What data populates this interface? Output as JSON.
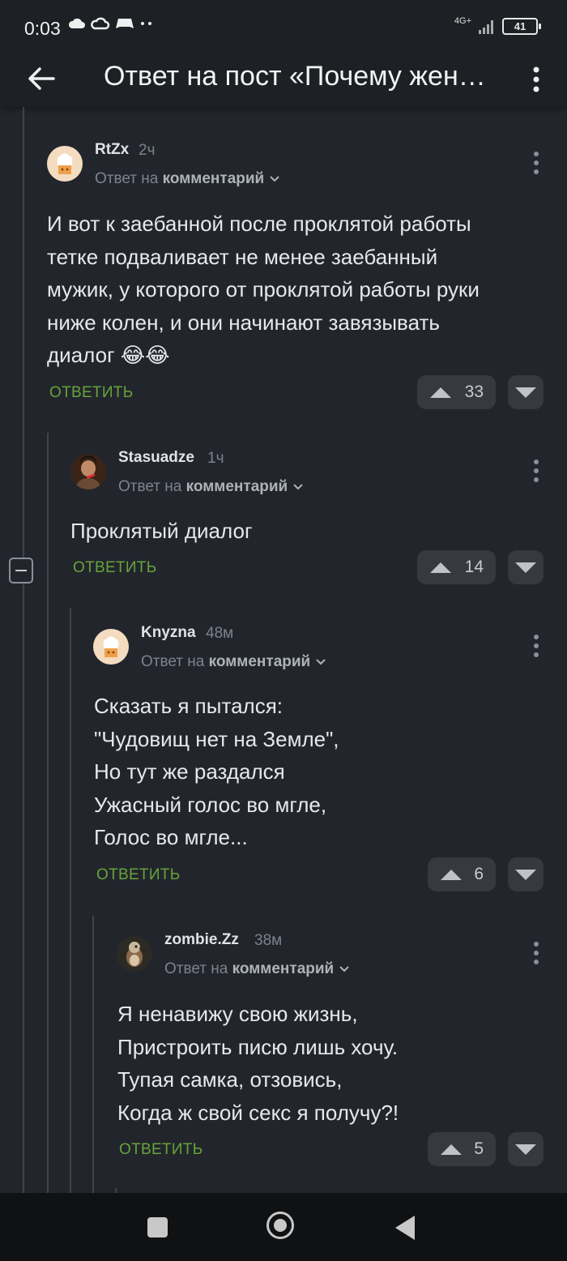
{
  "status_bar": {
    "time": "0:03",
    "network": "4G+",
    "battery": "41"
  },
  "app_bar": {
    "title": "Ответ на пост «Почему жен…"
  },
  "comments": [
    {
      "author": "RtZx",
      "time": "2ч",
      "reply_prefix": "Ответ на",
      "reply_target": "комментарий",
      "body": "И вот к заебанной после проклятой работы\nтетке подваливает не менее заебанный\nмужик, у которого от проклятой работы руки\nниже колен, и они начинают завязывать\nдиалог 😂😂",
      "reply_label": "ОТВЕТИТЬ",
      "votes": "33"
    },
    {
      "author": "Stasuadze",
      "time": "1ч",
      "reply_prefix": "Ответ на",
      "reply_target": "комментарий",
      "body": "Проклятый диалог",
      "reply_label": "ОТВЕТИТЬ",
      "votes": "14"
    },
    {
      "author": "Knyzna",
      "time": "48м",
      "reply_prefix": "Ответ на",
      "reply_target": "комментарий",
      "body": "Сказать я пытался:\n\"Чудовищ нет на Земле\",\nНо тут же раздался\nУжасный голос во мгле,\nГолос во мгле...",
      "reply_label": "ОТВЕТИТЬ",
      "votes": "6"
    },
    {
      "author": "zombie.Zz",
      "time": "38м",
      "reply_prefix": "Ответ на",
      "reply_target": "комментарий",
      "body": "Я ненавижу свою жизнь,\nПристроить писю лишь хочу.\nТупая самка, отзовись,\nКогда ж свой секс я получу?!",
      "reply_label": "ОТВЕТИТЬ",
      "votes": "5"
    }
  ],
  "colors": {
    "background": "#22262c",
    "accent_green": "#67a33b",
    "bar": "#1d2024"
  }
}
